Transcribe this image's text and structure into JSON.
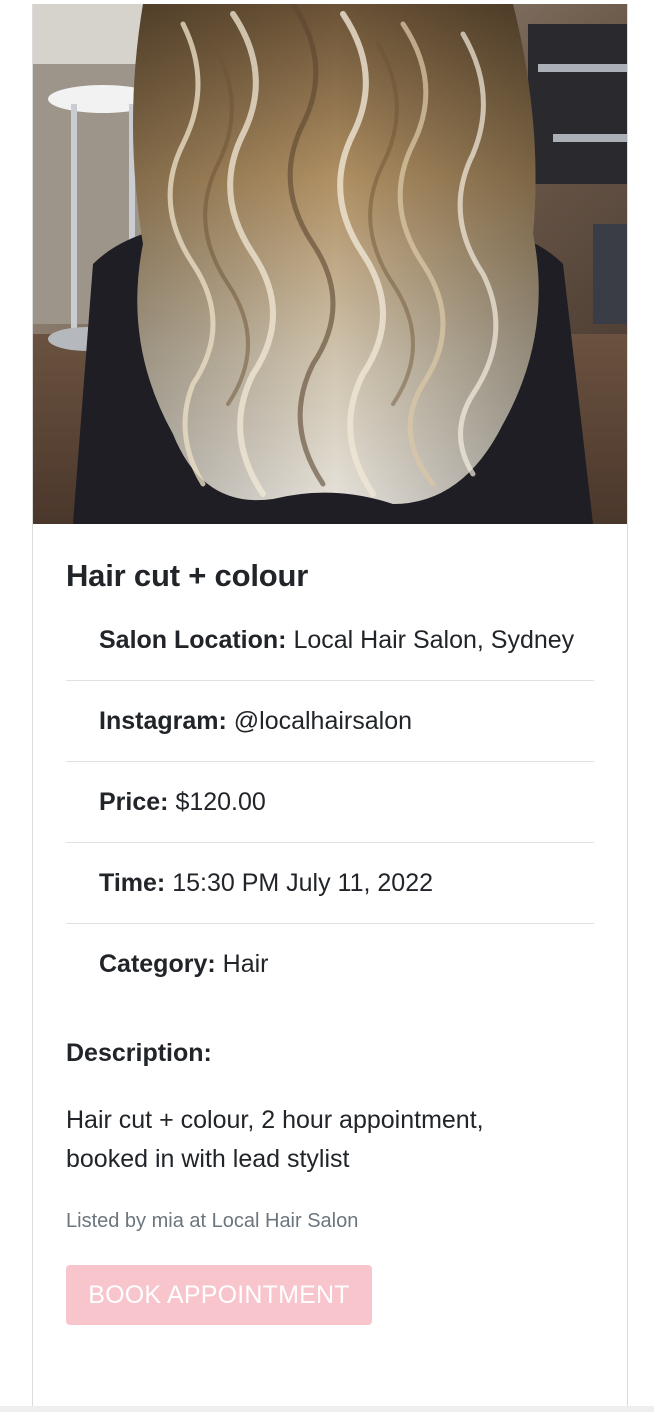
{
  "service": {
    "title": "Hair cut + colour",
    "image_alt": "Wavy balayage blonde hair photo in a salon",
    "details": [
      {
        "label": "Salon Location:",
        "value": "Local Hair Salon, Sydney"
      },
      {
        "label": "Instagram:",
        "value": "@localhairsalon"
      },
      {
        "label": "Price:",
        "value": "$120.00"
      },
      {
        "label": "Time:",
        "value": "15:30 PM July 11, 2022"
      },
      {
        "label": "Category:",
        "value": "Hair"
      }
    ],
    "description_label": "Description:",
    "description": "Hair cut + colour, 2 hour appointment, booked in with lead stylist",
    "listed_by": "Listed by mia at Local Hair Salon",
    "book_button": "BOOK APPOINTMENT"
  },
  "colors": {
    "button_bg": "#f8c5cd",
    "muted_text": "#6c757d",
    "divider": "#dee2e6"
  }
}
